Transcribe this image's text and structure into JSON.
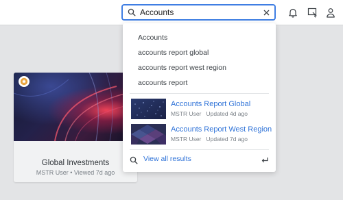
{
  "search": {
    "value": "Accounts"
  },
  "suggestions": [
    "Accounts",
    "accounts report global",
    "accounts report west region",
    "accounts report"
  ],
  "results": [
    {
      "title": "Accounts Report Global",
      "owner": "MSTR User",
      "updated": "Updated 4d ago"
    },
    {
      "title": "Accounts Report West Region",
      "owner": "MSTR User",
      "updated": "Updated 7d ago"
    }
  ],
  "view_all_label": "View all results",
  "card": {
    "title": "Global Investments",
    "meta": "MSTR User • Viewed 7d ago"
  },
  "colors": {
    "accent": "#3f7ee3",
    "link": "#2f73d8",
    "certified": "#e8a33c"
  },
  "icons": [
    "search-icon",
    "clear-icon",
    "bell-icon",
    "present-icon",
    "user-icon",
    "certified-star-icon",
    "enter-icon"
  ]
}
